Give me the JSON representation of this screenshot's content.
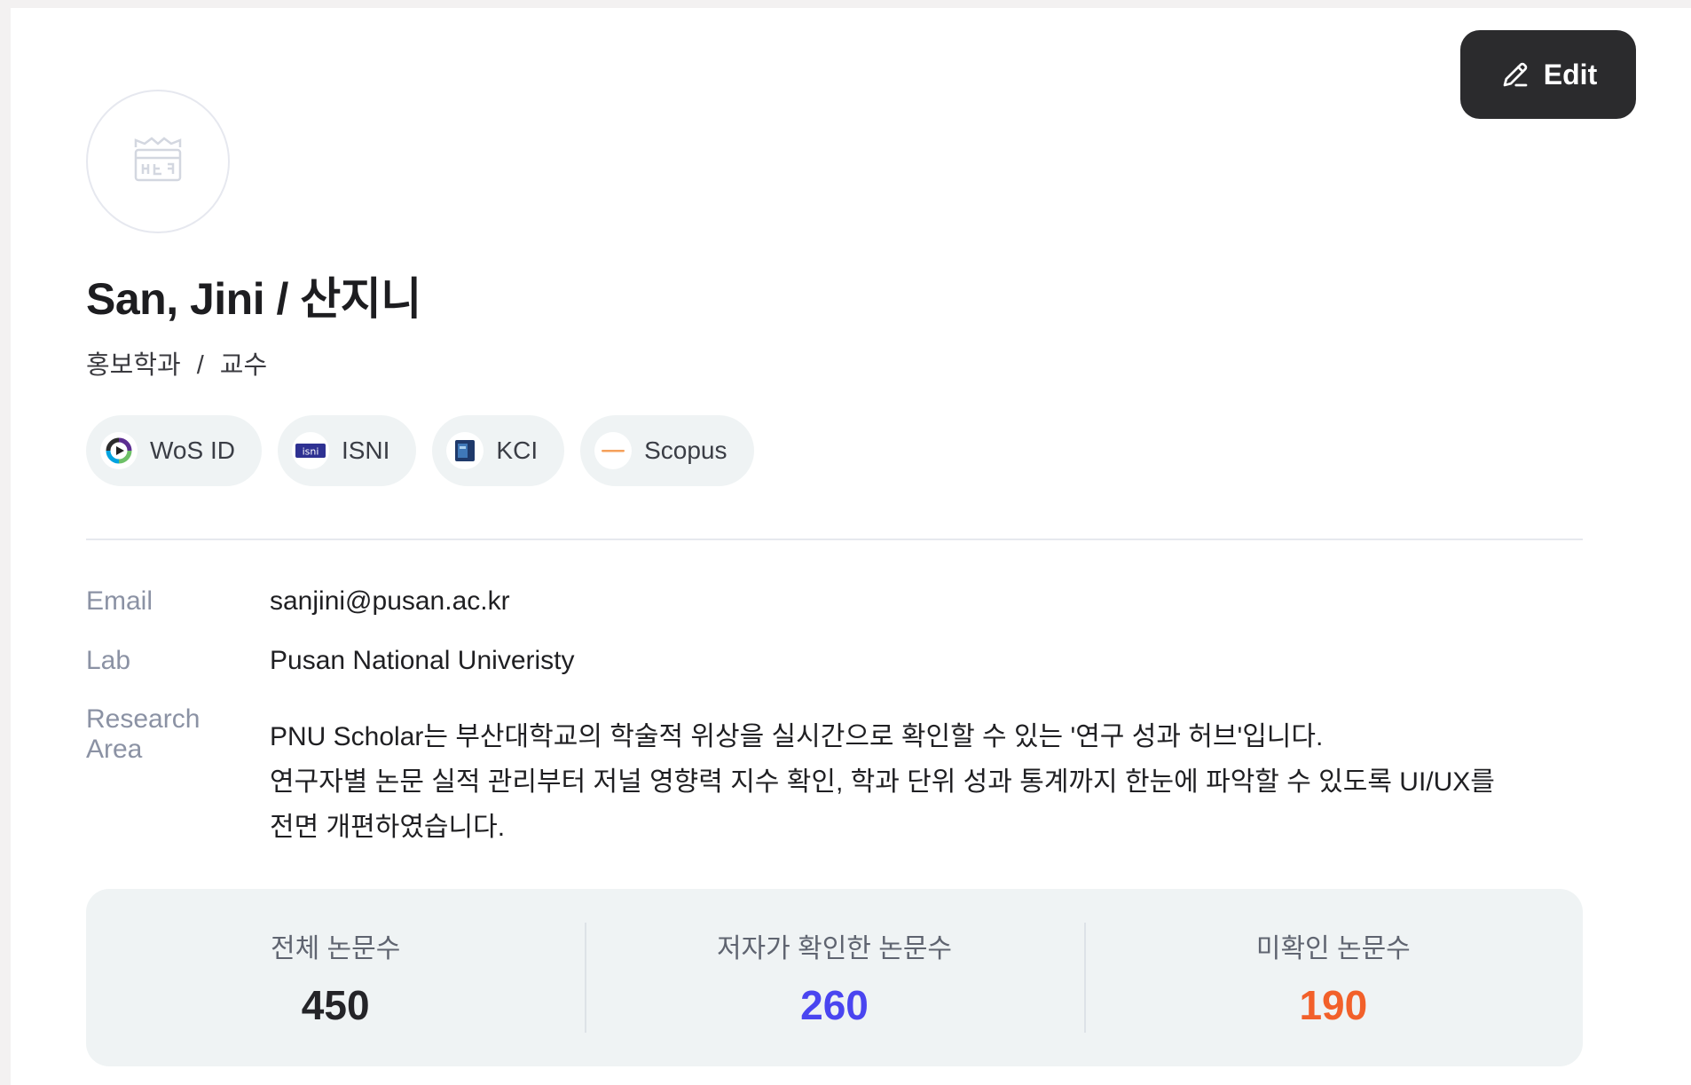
{
  "header": {
    "edit_label": "Edit",
    "edit_icon": "pencil-icon",
    "avatar_icon": "university-emblem-icon"
  },
  "profile": {
    "name": "San, Jini / 산지니",
    "department": "홍보학과",
    "separator": "/",
    "position": "교수"
  },
  "ids": [
    {
      "label": "WoS ID",
      "icon": "wos-logo-icon"
    },
    {
      "label": "ISNI",
      "icon": "isni-logo-icon"
    },
    {
      "label": "KCI",
      "icon": "kci-logo-icon"
    },
    {
      "label": "Scopus",
      "icon": "scopus-logo-icon"
    }
  ],
  "info": {
    "email_label": "Email",
    "email_value": "sanjini@pusan.ac.kr",
    "lab_label": "Lab",
    "lab_value": "Pusan National Univeristy",
    "research_label_1": "Research",
    "research_label_2": "Area",
    "research_lines": [
      "PNU Scholar는 부산대학교의 학술적 위상을 실시간으로 확인할 수 있는 '연구 성과 허브'입니다.",
      "연구자별 논문 실적 관리부터 저널 영향력 지수 확인, 학과 단위 성과 통계까지 한눈에 파악할 수 있도록 UI/UX를",
      "전면 개편하였습니다."
    ]
  },
  "stats": [
    {
      "label": "전체 논문수",
      "value": "450",
      "color": "#242428"
    },
    {
      "label": "저자가 확인한 논문수",
      "value": "260",
      "color": "#4a45f0"
    },
    {
      "label": "미확인 논문수",
      "value": "190",
      "color": "#f2602a"
    }
  ],
  "colors": {
    "edit_button_bg": "#2b2b2d",
    "chip_bg": "#eff3f4",
    "stats_bg": "#eff3f4",
    "label_gray": "#8b92a4"
  }
}
